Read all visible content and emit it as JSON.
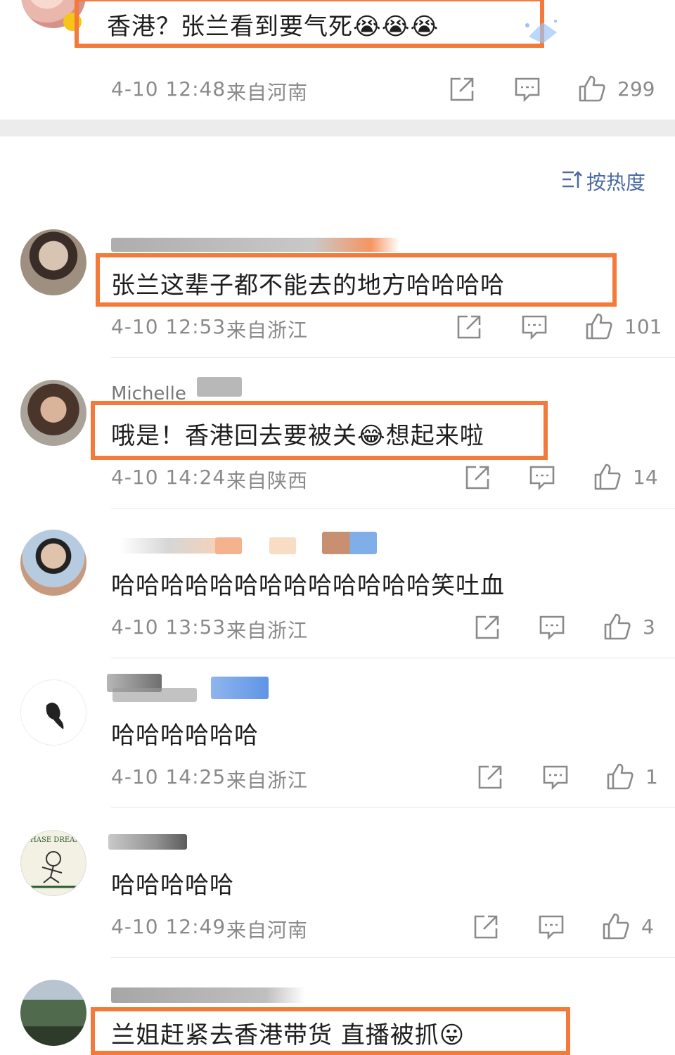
{
  "top_comment": {
    "text": "香港？张兰看到要气死😭😭😭",
    "time": "4-10 12:48",
    "location": "来自河南",
    "likes": "299"
  },
  "sort_label": "按热度",
  "comments": [
    {
      "name": "",
      "text": "张兰这辈子都不能去的地方哈哈哈哈",
      "time": "4-10 12:53",
      "location": "来自浙江",
      "likes": "101",
      "highlighted": true
    },
    {
      "name": "Michelle",
      "text": "哦是！香港回去要被关😂想起来啦",
      "time": "4-10 14:24",
      "location": "来自陕西",
      "likes": "14",
      "highlighted": true
    },
    {
      "name": "",
      "text": "哈哈哈哈哈哈哈哈哈哈哈哈哈笑吐血",
      "time": "4-10 13:53",
      "location": "来自浙江",
      "likes": "3",
      "highlighted": false
    },
    {
      "name": "",
      "text": "哈哈哈哈哈哈",
      "time": "4-10 14:25",
      "location": "来自浙江",
      "likes": "1",
      "highlighted": false
    },
    {
      "name": "",
      "text": "哈哈哈哈哈",
      "time": "4-10 12:49",
      "location": "来自河南",
      "likes": "4",
      "highlighted": false
    },
    {
      "name": "",
      "text": "兰姐赶紧去香港带货 直播被抓😛",
      "highlighted": true
    }
  ],
  "avatar_logo_text": "CHASE DREAM",
  "colors": {
    "highlight": "#f47a3b",
    "link": "#4d6aa6",
    "meta": "#8a8a8a"
  }
}
